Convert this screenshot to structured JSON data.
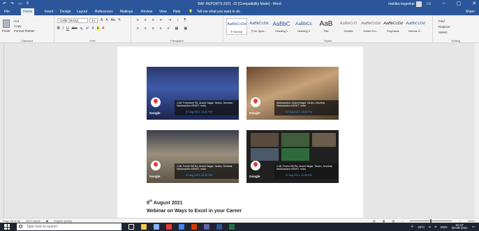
{
  "titlebar": {
    "doc_title": "BAF REPORTS 2021 -22 [Compatibility Mode] - Word",
    "user": "mahika nagvekar",
    "qat": [
      "↶",
      "↷",
      "▭",
      "≡"
    ],
    "window_controls": [
      "▭",
      "–",
      "▢",
      "✕"
    ]
  },
  "tabs": [
    "File",
    "Home",
    "Insert",
    "Design",
    "Layout",
    "References",
    "Mailings",
    "Review",
    "View",
    "Help"
  ],
  "tell_me": "Tell me what you want to do",
  "share": "Share",
  "ribbon": {
    "clipboard": {
      "paste": "Paste",
      "cut": "Cut",
      "copy": "Copy",
      "format_painter": "Format Painter",
      "label": "Clipboard"
    },
    "font": {
      "family": "Calibri (Body)",
      "size": "14",
      "row1": [
        "A",
        "A",
        "Aa",
        "✎"
      ],
      "row2": [
        "B",
        "I",
        "U",
        "abc",
        "x₂",
        "x²",
        "A",
        "A",
        "A"
      ],
      "label": "Font"
    },
    "paragraph": {
      "row1": [
        "≡",
        "≡",
        "≡",
        "⇤",
        "⇥",
        "↕",
        "¶"
      ],
      "row2": [
        "≡",
        "≡",
        "≡",
        "≡",
        "≡",
        "▦",
        "▦"
      ],
      "label": "Paragraph"
    },
    "styles": [
      {
        "sample": "AaBbCcDd",
        "name": "¶ Normal"
      },
      {
        "sample": "AaBbCcDd",
        "name": "¶ No Spac..."
      },
      {
        "sample": "AaBbC",
        "name": "Heading 1"
      },
      {
        "sample": "AaBbCc",
        "name": "Heading 2"
      },
      {
        "sample": "AaB",
        "name": "Title"
      },
      {
        "sample": "AaBbCcD",
        "name": "Subtitle"
      },
      {
        "sample": "AaBbCcDd",
        "name": "Subtle Em..."
      },
      {
        "sample": "AaBbCcDd",
        "name": "Emphasis"
      },
      {
        "sample": "AaBbCcDd",
        "name": "Intense E..."
      }
    ],
    "styles_label": "Styles",
    "editing": {
      "find": "Find",
      "replace": "Replace",
      "select": "Select",
      "label": "Editing"
    }
  },
  "photos": [
    {
      "address": "2-38, Foreshore Rd, Anand Nagar, Tardeo, Mumbai, Maharashtra 400007, India",
      "stamp": "07 Aug 2021, 12:31 PM",
      "google": "Google"
    },
    {
      "address": "Maharashtra, Anand Nagar, Tardeo, Mumbai, Maharashtra 400007, India",
      "stamp": "07 Aug 2021, 12:32 PM",
      "google": "Google"
    },
    {
      "address": "2-38, Forest Hill Rd, Anand Nagar, Tardeo, Mumbai, Maharashtra 400007, India",
      "stamp": "07 Aug 2021, 12:33 PM",
      "google": "Google"
    },
    {
      "address": "2-38, Forest Hill Rd, Anand Nagar, Tardeo, Mumbai, Maharashtra 400007, India",
      "stamp": "07 Aug 2021, 12:35 PM",
      "google": "Google"
    }
  ],
  "doc_text": {
    "date_day": "9",
    "date_suffix": "th",
    "date_rest": " August 2021",
    "webinar": "Webinar on Ways to Excel in your Career"
  },
  "statusbar": {
    "page": "Page 28 of 58",
    "words": "3257 words",
    "language": "English (India)",
    "zoom": "100%"
  },
  "taskbar": {
    "search_placeholder": "Type here to search",
    "weather": "29°C",
    "time": "02:47",
    "date": "09-09-2021",
    "lang": "ENG"
  },
  "colors": {
    "word_blue": "#2b579a",
    "taskbar": "#1f2430"
  }
}
